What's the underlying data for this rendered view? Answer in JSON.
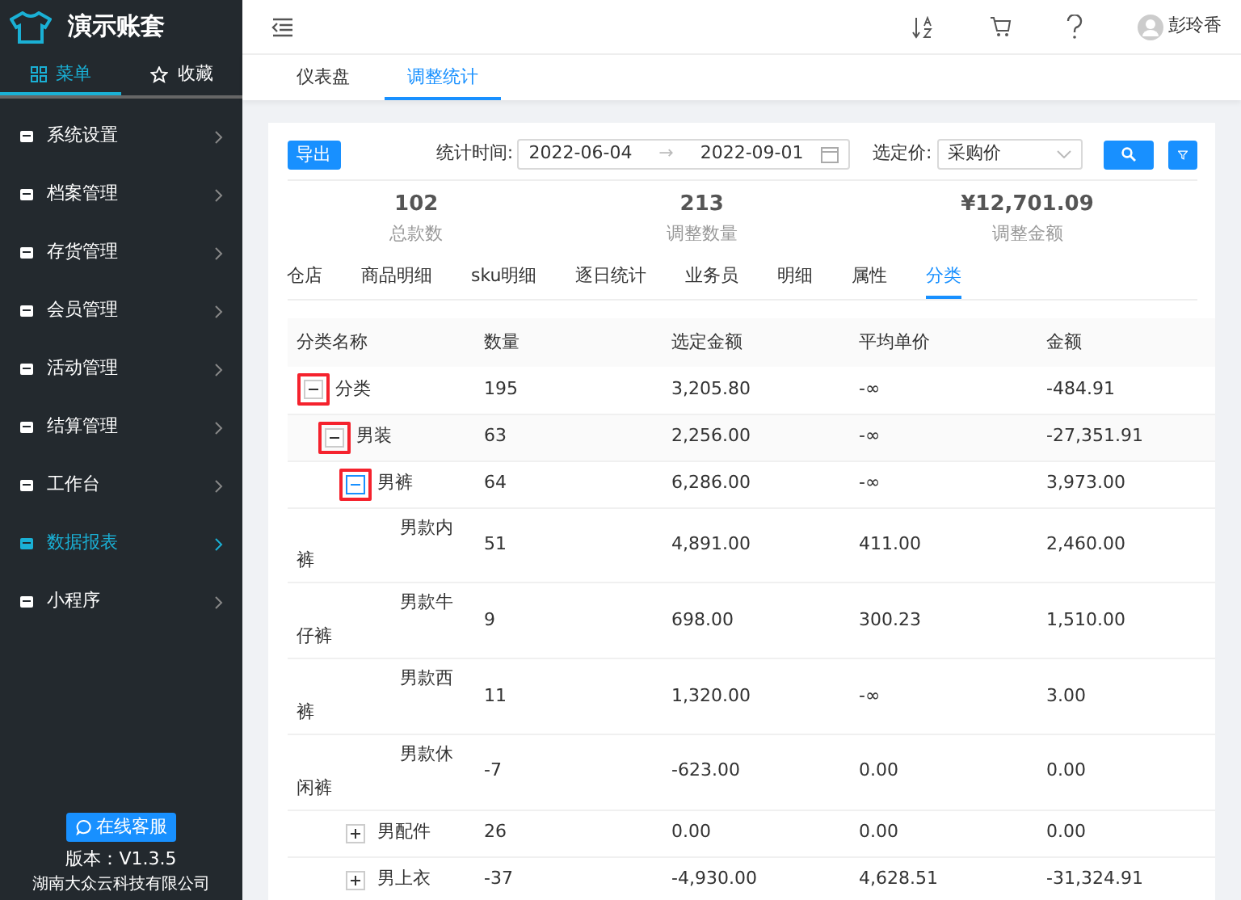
{
  "app": {
    "title": "演示账套"
  },
  "sidebar_tabs": [
    {
      "label": "菜单",
      "selected": true
    },
    {
      "label": "收藏",
      "selected": false
    }
  ],
  "sidebar": {
    "items": [
      {
        "label": "系统设置",
        "selected": false
      },
      {
        "label": "档案管理",
        "selected": false
      },
      {
        "label": "存货管理",
        "selected": false
      },
      {
        "label": "会员管理",
        "selected": false
      },
      {
        "label": "活动管理",
        "selected": false
      },
      {
        "label": "结算管理",
        "selected": false
      },
      {
        "label": "工作台",
        "selected": false
      },
      {
        "label": "数据报表",
        "selected": true
      },
      {
        "label": "小程序",
        "selected": false
      }
    ],
    "service_button": "在线客服",
    "version": "版本：V1.3.5",
    "company": "湖南大众云科技有限公司"
  },
  "header": {
    "user": "彭玲香"
  },
  "page_tabs": [
    {
      "label": "仪表盘",
      "selected": false
    },
    {
      "label": "调整统计",
      "selected": true
    }
  ],
  "toolbar": {
    "export": "导出",
    "date_label": "统计时间:",
    "date_from": "2022-06-04",
    "range_separator": "→",
    "date_to": "2022-09-01",
    "price_label": "选定价:",
    "price_value": "采购价"
  },
  "stats": [
    {
      "value": "102",
      "label": "总款数"
    },
    {
      "value": "213",
      "label": "调整数量"
    },
    {
      "value": "¥12,701.09",
      "label": "调整金额"
    }
  ],
  "report_tabs": [
    {
      "label": "仓店",
      "selected": false
    },
    {
      "label": "商品明细",
      "selected": false
    },
    {
      "label": "sku明细",
      "selected": false
    },
    {
      "label": "逐日统计",
      "selected": false
    },
    {
      "label": "业务员",
      "selected": false
    },
    {
      "label": "明细",
      "selected": false
    },
    {
      "label": "属性",
      "selected": false
    },
    {
      "label": "分类",
      "selected": true
    }
  ],
  "table": {
    "columns": [
      "分类名称",
      "数量",
      "选定金额",
      "平均单价",
      "金额"
    ],
    "rows": [
      {
        "cells": [
          "分类",
          "195",
          "3,205.80",
          "-∞",
          "-484.91"
        ],
        "expanded": true,
        "highlighted": true,
        "hovered": false,
        "children": [
          {
            "cells": [
              "男装",
              "63",
              "2,256.00",
              "-∞",
              "-27,351.91"
            ],
            "expanded": true,
            "highlighted": true,
            "hovered": false,
            "children": [
              {
                "cells": [
                  "男裤",
                  "64",
                  "6,286.00",
                  "-∞",
                  "3,973.00"
                ],
                "expanded": true,
                "highlighted": true,
                "hovered": true,
                "children": [
                  {
                    "cells": [
                      "男款内裤",
                      "51",
                      "4,891.00",
                      "411.00",
                      "2,460.00"
                    ]
                  },
                  {
                    "cells": [
                      "男款牛仔裤",
                      "9",
                      "698.00",
                      "300.23",
                      "1,510.00"
                    ]
                  },
                  {
                    "cells": [
                      "男款西裤",
                      "11",
                      "1,320.00",
                      "-∞",
                      "3.00"
                    ]
                  },
                  {
                    "cells": [
                      "男款休闲裤",
                      "-7",
                      "-623.00",
                      "0.00",
                      "0.00"
                    ]
                  }
                ]
              },
              {
                "cells": [
                  "男配件",
                  "26",
                  "0.00",
                  "0.00",
                  "0.00"
                ],
                "expanded": false,
                "highlighted": false,
                "hovered": false
              },
              {
                "cells": [
                  "男上衣",
                  "-37",
                  "-4,930.00",
                  "4,628.51",
                  "-31,324.91"
                ],
                "expanded": false,
                "highlighted": false,
                "hovered": false
              }
            ]
          }
        ]
      }
    ]
  }
}
